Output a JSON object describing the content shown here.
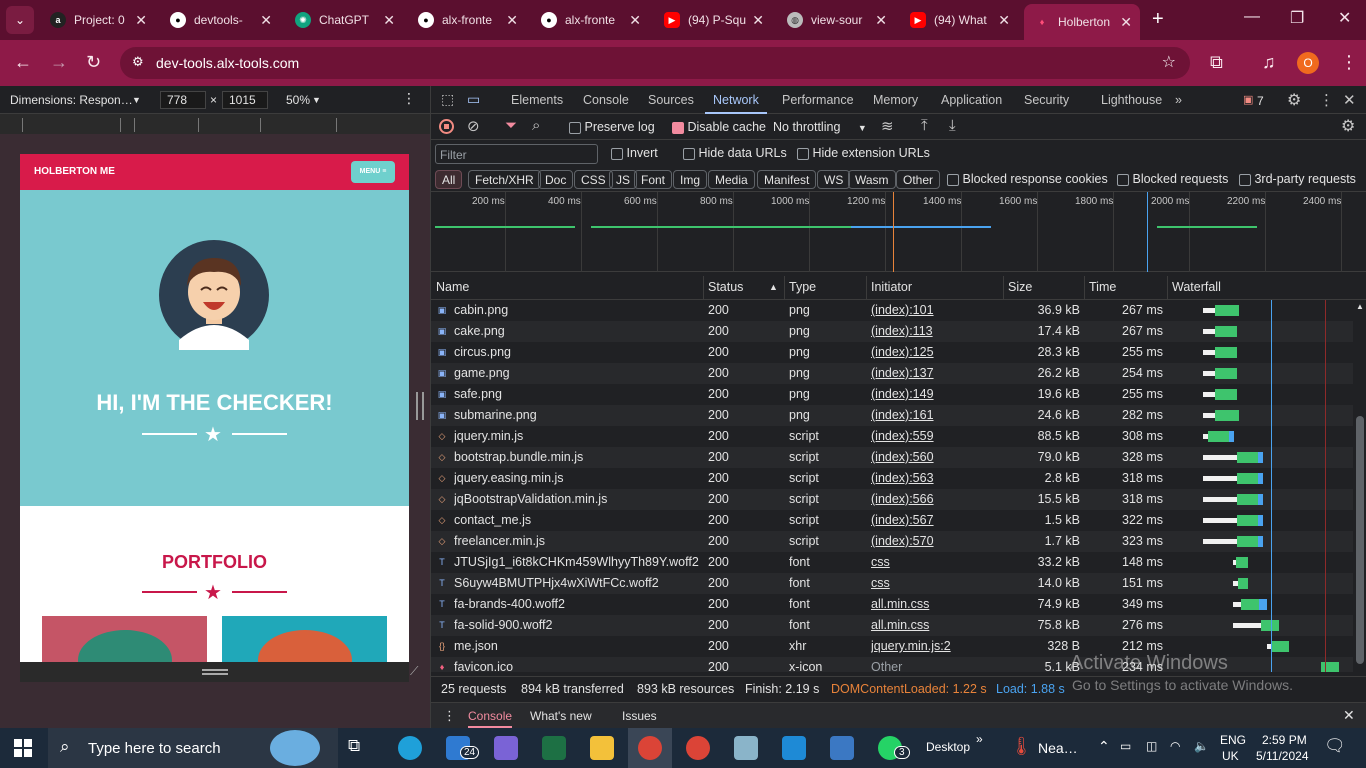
{
  "browser": {
    "tabs": [
      {
        "label": "Project: 0",
        "icon": "alx-icon"
      },
      {
        "label": "devtools-",
        "icon": "github-icon"
      },
      {
        "label": "ChatGPT",
        "icon": "chatgpt-icon"
      },
      {
        "label": "alx-fronte",
        "icon": "github-icon"
      },
      {
        "label": "alx-fronte",
        "icon": "github-icon"
      },
      {
        "label": "(94) P-Squ",
        "icon": "youtube-icon"
      },
      {
        "label": "view-sour",
        "icon": "globe-icon"
      },
      {
        "label": "(94) What",
        "icon": "youtube-icon"
      },
      {
        "label": "Holberton",
        "icon": "holberton-icon"
      }
    ],
    "url": "dev-tools.alx-tools.com",
    "profile_initial": "O"
  },
  "device_toolbar": {
    "dimensions_label": "Dimensions: Respon…",
    "width": "778",
    "height": "1015",
    "times": "×",
    "zoom": "50%"
  },
  "preview": {
    "brand": "HOLBERTON ME",
    "menu": "MENU ≡",
    "hero_title": "HI, I'M THE CHECKER!",
    "portfolio_title": "PORTFOLIO"
  },
  "devtools": {
    "tabs": [
      "Elements",
      "Console",
      "Sources",
      "Network",
      "Performance",
      "Memory",
      "Application",
      "Security",
      "Lighthouse"
    ],
    "active_tab": "Network",
    "issues_count": "7",
    "preserve_log": "Preserve log",
    "disable_cache": "Disable cache",
    "throttling": "No throttling",
    "filter_placeholder": "Filter",
    "invert": "Invert",
    "hide_data_urls": "Hide data URLs",
    "hide_extension_urls": "Hide extension URLs",
    "type_filters": [
      "All",
      "Fetch/XHR",
      "Doc",
      "CSS",
      "JS",
      "Font",
      "Img",
      "Media",
      "Manifest",
      "WS",
      "Wasm",
      "Other"
    ],
    "blocked_response_cookies": "Blocked response cookies",
    "blocked_requests": "Blocked requests",
    "third_party": "3rd-party requests",
    "overview_ticks": [
      "200 ms",
      "400 ms",
      "600 ms",
      "800 ms",
      "1000 ms",
      "1200 ms",
      "1400 ms",
      "1600 ms",
      "1800 ms",
      "2000 ms",
      "2200 ms",
      "2400 ms"
    ],
    "columns": [
      "Name",
      "Status",
      "Type",
      "Initiator",
      "Size",
      "Time",
      "Waterfall"
    ],
    "rows": [
      {
        "name": "cabin.png",
        "status": "200",
        "type": "png",
        "initiator": "(index):101",
        "size": "36.9 kB",
        "time": "267 ms",
        "icon": "image-icon"
      },
      {
        "name": "cake.png",
        "status": "200",
        "type": "png",
        "initiator": "(index):113",
        "size": "17.4 kB",
        "time": "267 ms",
        "icon": "image-icon"
      },
      {
        "name": "circus.png",
        "status": "200",
        "type": "png",
        "initiator": "(index):125",
        "size": "28.3 kB",
        "time": "255 ms",
        "icon": "image-icon"
      },
      {
        "name": "game.png",
        "status": "200",
        "type": "png",
        "initiator": "(index):137",
        "size": "26.2 kB",
        "time": "254 ms",
        "icon": "image-icon"
      },
      {
        "name": "safe.png",
        "status": "200",
        "type": "png",
        "initiator": "(index):149",
        "size": "19.6 kB",
        "time": "255 ms",
        "icon": "image-icon"
      },
      {
        "name": "submarine.png",
        "status": "200",
        "type": "png",
        "initiator": "(index):161",
        "size": "24.6 kB",
        "time": "282 ms",
        "icon": "image-icon"
      },
      {
        "name": "jquery.min.js",
        "status": "200",
        "type": "script",
        "initiator": "(index):559",
        "size": "88.5 kB",
        "time": "308 ms",
        "icon": "script-icon"
      },
      {
        "name": "bootstrap.bundle.min.js",
        "status": "200",
        "type": "script",
        "initiator": "(index):560",
        "size": "79.0 kB",
        "time": "328 ms",
        "icon": "script-icon"
      },
      {
        "name": "jquery.easing.min.js",
        "status": "200",
        "type": "script",
        "initiator": "(index):563",
        "size": "2.8 kB",
        "time": "318 ms",
        "icon": "script-icon"
      },
      {
        "name": "jqBootstrapValidation.min.js",
        "status": "200",
        "type": "script",
        "initiator": "(index):566",
        "size": "15.5 kB",
        "time": "318 ms",
        "icon": "script-icon"
      },
      {
        "name": "contact_me.js",
        "status": "200",
        "type": "script",
        "initiator": "(index):567",
        "size": "1.5 kB",
        "time": "322 ms",
        "icon": "script-icon"
      },
      {
        "name": "freelancer.min.js",
        "status": "200",
        "type": "script",
        "initiator": "(index):570",
        "size": "1.7 kB",
        "time": "323 ms",
        "icon": "script-icon"
      },
      {
        "name": "JTUSjIg1_i6t8kCHKm459WlhyyTh89Y.woff2",
        "status": "200",
        "type": "font",
        "initiator": "css",
        "size": "33.2 kB",
        "time": "148 ms",
        "icon": "font-icon"
      },
      {
        "name": "S6uyw4BMUTPHjx4wXiWtFCc.woff2",
        "status": "200",
        "type": "font",
        "initiator": "css",
        "size": "14.0 kB",
        "time": "151 ms",
        "icon": "font-icon"
      },
      {
        "name": "fa-brands-400.woff2",
        "status": "200",
        "type": "font",
        "initiator": "all.min.css",
        "size": "74.9 kB",
        "time": "349 ms",
        "icon": "font-icon"
      },
      {
        "name": "fa-solid-900.woff2",
        "status": "200",
        "type": "font",
        "initiator": "all.min.css",
        "size": "75.8 kB",
        "time": "276 ms",
        "icon": "font-icon"
      },
      {
        "name": "me.json",
        "status": "200",
        "type": "xhr",
        "initiator": "jquery.min.js:2",
        "size": "328 B",
        "time": "212 ms",
        "icon": "json-icon"
      },
      {
        "name": "favicon.ico",
        "status": "200",
        "type": "x-icon",
        "initiator": "Other",
        "size": "5.1 kB",
        "time": "234 ms",
        "icon": "favicon-icon"
      }
    ],
    "summary": {
      "requests": "25 requests",
      "transferred": "894 kB transferred",
      "resources": "893 kB resources",
      "finish": "Finish: 2.19 s",
      "dcl": "DOMContentLoaded: 1.22 s",
      "load": "Load: 1.88 s"
    },
    "drawer_tabs": [
      "Console",
      "What's new",
      "Issues"
    ]
  },
  "watermark": {
    "line1": "Activate Windows",
    "line2": "Go to Settings to activate Windows."
  },
  "taskbar": {
    "search_placeholder": "Type here to search",
    "mail_badge": "24",
    "whatsapp_badge": "3",
    "desktop": "Desktop",
    "weather": "Nea…",
    "lang1": "ENG",
    "lang2": "UK",
    "time": "2:59 PM",
    "date": "5/11/2024"
  },
  "colors": {
    "tabstrip": "#5b0f2f",
    "toolbar": "#8e1a48",
    "accent": "#a8c7fa",
    "holberton_red": "#d81b4a",
    "hero_teal": "#79c9cf",
    "waterfall_green": "#3ec46d",
    "waterfall_blue": "#4aa3f0"
  }
}
